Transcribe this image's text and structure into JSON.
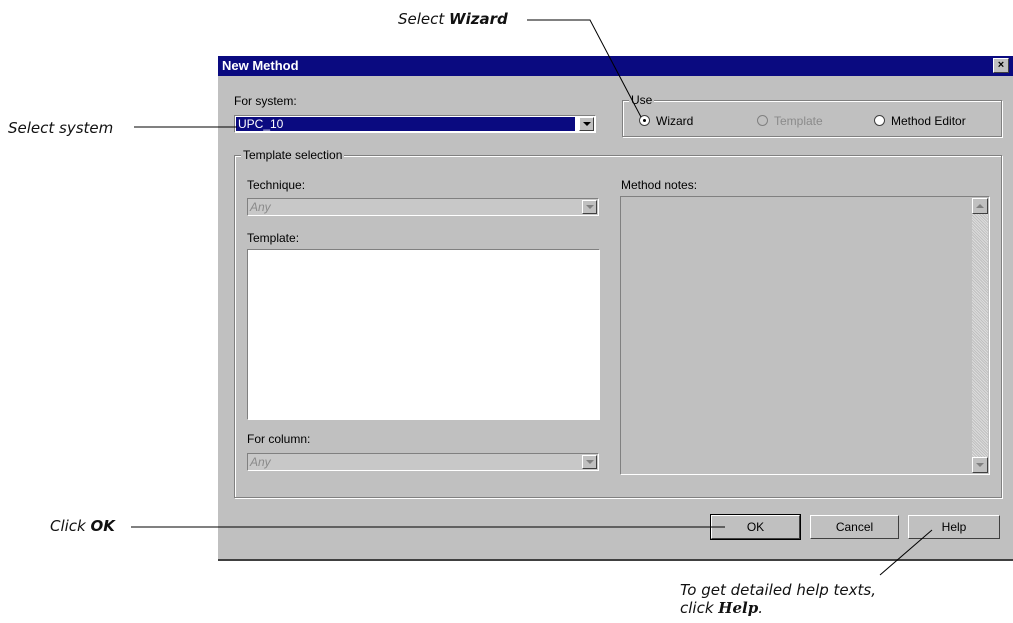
{
  "callouts": {
    "select_wizard_prefix": "Select ",
    "select_wizard_bold": "Wizard",
    "select_system": "Select system",
    "click_ok_prefix": "Click ",
    "click_ok_bold": "OK",
    "help_line1": "To get detailed help texts,",
    "help_line2_prefix": "click ",
    "help_line2_bold": "Help",
    "help_line2_suffix": "."
  },
  "dialog": {
    "title": "New Method",
    "close_label": "×",
    "for_system_label": "For system:",
    "system_value": "UPC_10",
    "use_group": {
      "legend": "Use",
      "options": [
        "Wizard",
        "Template",
        "Method Editor"
      ],
      "selected": "Wizard",
      "disabled": [
        "Template"
      ]
    },
    "template_selection": {
      "legend": "Template selection",
      "technique_label": "Technique:",
      "technique_value": "Any",
      "template_label": "Template:",
      "for_column_label": "For column:",
      "for_column_value": "Any",
      "method_notes_label": "Method notes:"
    },
    "buttons": {
      "ok": "OK",
      "cancel": "Cancel",
      "help": "Help"
    }
  }
}
